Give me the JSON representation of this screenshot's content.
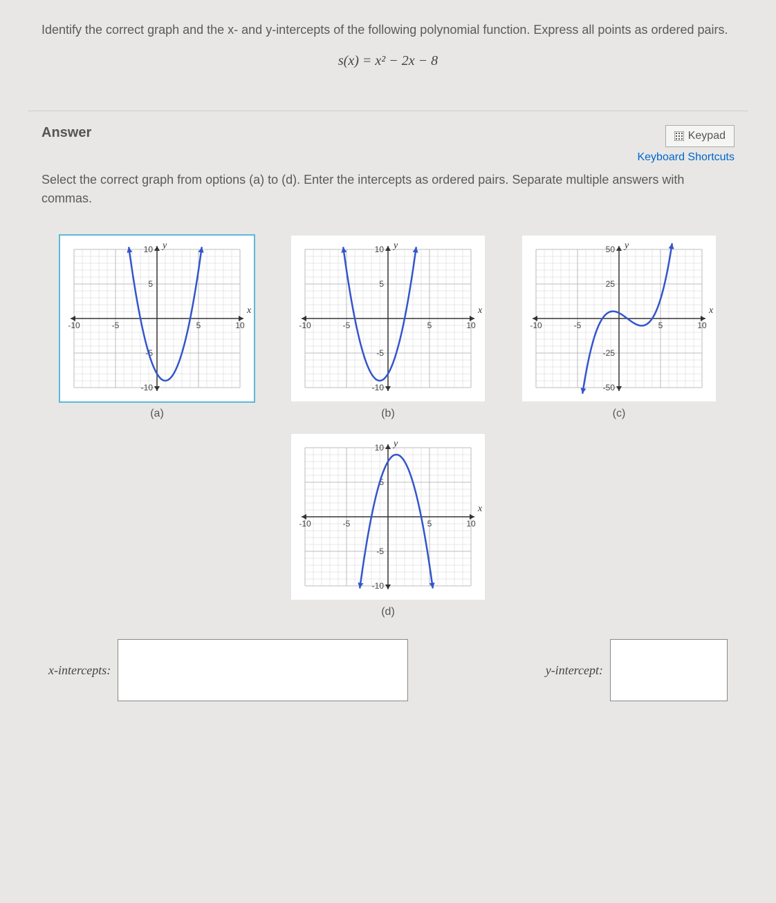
{
  "question": {
    "text": "Identify the correct graph and the x- and y-intercepts of the following polynomial function. Express all points as ordered pairs.",
    "formula": "s(x) = x² − 2x − 8"
  },
  "answer": {
    "title": "Answer",
    "keypad_label": "Keypad",
    "shortcuts_label": "Keyboard Shortcuts",
    "instructions": "Select the correct graph from options (a) to (d). Enter the intercepts as ordered pairs. Separate multiple answers with commas."
  },
  "graphs": {
    "a": {
      "label": "(a)"
    },
    "b": {
      "label": "(b)"
    },
    "c": {
      "label": "(c)"
    },
    "d": {
      "label": "(d)"
    }
  },
  "inputs": {
    "x_label": "x-intercepts:",
    "y_label": "y-intercept:",
    "x_value": "",
    "y_value": ""
  },
  "chart_data": [
    {
      "id": "a",
      "type": "line",
      "title": "(a)",
      "xlabel": "x",
      "ylabel": "y",
      "xlim": [
        -10,
        10
      ],
      "ylim": [
        -10,
        10
      ],
      "xticks": [
        -10,
        -5,
        5,
        10
      ],
      "yticks": [
        -10,
        -5,
        5,
        10
      ],
      "function": "y = x^2 - 2x - 8",
      "vertex": [
        1,
        -9
      ],
      "x_intercepts": [
        [
          -2,
          0
        ],
        [
          4,
          0
        ]
      ],
      "y_intercept": [
        0,
        -8
      ]
    },
    {
      "id": "b",
      "type": "line",
      "title": "(b)",
      "xlabel": "x",
      "ylabel": "y",
      "xlim": [
        -10,
        10
      ],
      "ylim": [
        -10,
        10
      ],
      "xticks": [
        -10,
        -5,
        5,
        10
      ],
      "yticks": [
        -10,
        -5,
        5,
        10
      ],
      "function": "y = x^2 + 2x - 8",
      "vertex": [
        -1,
        -9
      ],
      "x_intercepts": [
        [
          -4,
          0
        ],
        [
          2,
          0
        ]
      ],
      "y_intercept": [
        0,
        -8
      ]
    },
    {
      "id": "c",
      "type": "line",
      "title": "(c)",
      "xlabel": "x",
      "ylabel": "y",
      "xlim": [
        -10,
        10
      ],
      "ylim": [
        -50,
        50
      ],
      "xticks": [
        -10,
        -5,
        5,
        10
      ],
      "yticks": [
        -50,
        -25,
        25,
        50
      ],
      "function": "cubic-like through (-2,0),(4,0), rising right",
      "x_intercepts": [
        [
          -2,
          0
        ],
        [
          4,
          0
        ]
      ]
    },
    {
      "id": "d",
      "type": "line",
      "title": "(d)",
      "xlabel": "x",
      "ylabel": "y",
      "xlim": [
        -10,
        10
      ],
      "ylim": [
        -10,
        10
      ],
      "xticks": [
        -10,
        -5,
        5,
        10
      ],
      "yticks": [
        -10,
        -5,
        5,
        10
      ],
      "function": "y = -x^2 + 2x + 8",
      "vertex": [
        1,
        9
      ],
      "x_intercepts": [
        [
          -2,
          0
        ],
        [
          4,
          0
        ]
      ],
      "y_intercept": [
        0,
        8
      ]
    }
  ]
}
